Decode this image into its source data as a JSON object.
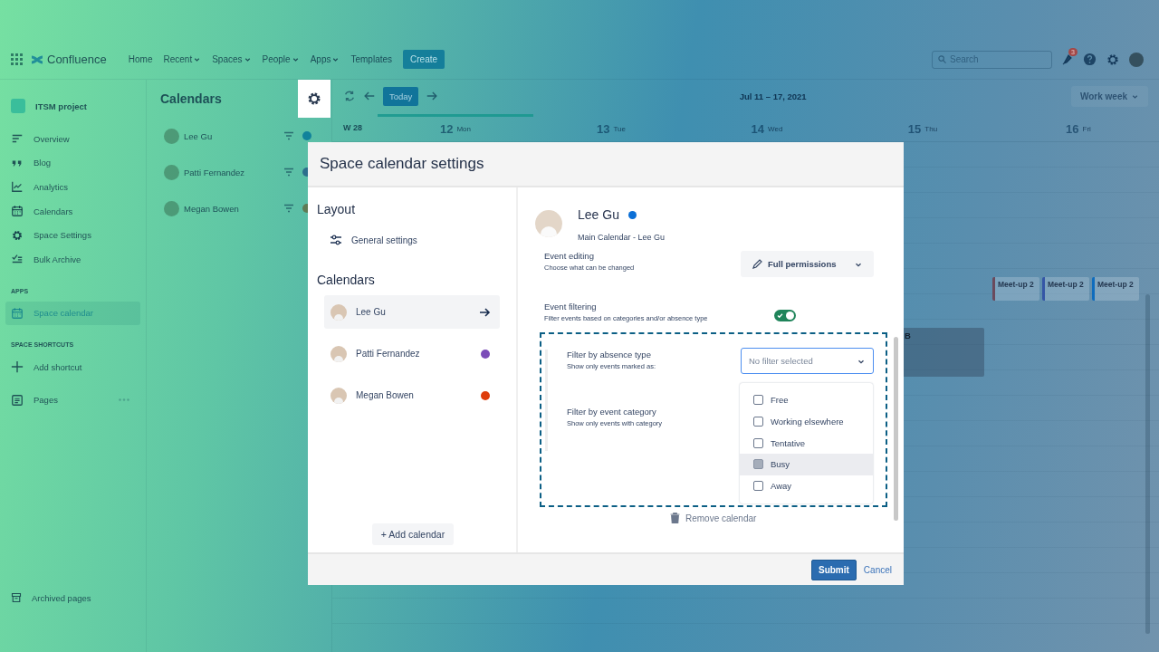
{
  "top_nav": {
    "product": "Confluence",
    "links": [
      {
        "label": "Home",
        "dropdown": false
      },
      {
        "label": "Recent",
        "dropdown": true
      },
      {
        "label": "Spaces",
        "dropdown": true
      },
      {
        "label": "People",
        "dropdown": true
      },
      {
        "label": "Apps",
        "dropdown": true
      },
      {
        "label": "Templates",
        "dropdown": false
      }
    ],
    "create_button": "Create",
    "search": {
      "placeholder": "Search"
    },
    "notification_count": "3"
  },
  "space_sidebar": {
    "space_name": "ITSM project",
    "items": [
      {
        "label": "Overview"
      },
      {
        "label": "Blog"
      },
      {
        "label": "Analytics"
      },
      {
        "label": "Calendars"
      },
      {
        "label": "Space Settings"
      },
      {
        "label": "Bulk Archive"
      }
    ],
    "apps_heading": "APPS",
    "apps": [
      {
        "label": "Space calendar",
        "selected": true
      }
    ],
    "shortcuts_heading": "SPACE SHORTCUTS",
    "add_shortcut": "Add shortcut",
    "pages": "Pages",
    "archived": "Archived pages"
  },
  "calendar_list": {
    "title": "Calendars",
    "items": [
      {
        "name": "Lee Gu",
        "color": "#11829b"
      },
      {
        "name": "Patti Fernandez",
        "color": "#2d6f8c"
      },
      {
        "name": "Megan Bowen",
        "color": "#5f7b55"
      }
    ]
  },
  "calendar": {
    "today_button": "Today",
    "range": "Jul 11 – 17, 2021",
    "view": "Work week",
    "week": "W 28",
    "days": [
      {
        "number": "12",
        "name": "Mon",
        "selected": true
      },
      {
        "number": "13",
        "name": "Tue",
        "selected": false
      },
      {
        "number": "14",
        "name": "Wed",
        "selected": false
      },
      {
        "number": "15",
        "name": "Thu",
        "selected": false
      },
      {
        "number": "16",
        "name": "Fri",
        "selected": false
      }
    ],
    "events": [
      {
        "label": "Meet-up 2",
        "color": "#6b4a5c"
      },
      {
        "label": "Meet-up 2",
        "color": "#3556a6"
      },
      {
        "label": "Meet-up 2",
        "color": "#0f6cbd"
      },
      {
        "label": "B"
      }
    ]
  },
  "modal": {
    "title": "Space calendar settings",
    "layout_heading": "Layout",
    "general_settings": "General settings",
    "calendars_heading": "Calendars",
    "calendars": [
      {
        "name": "Lee Gu",
        "selected": true
      },
      {
        "name": "Patti Fernandez",
        "selected": false,
        "color": "#7b4cb8"
      },
      {
        "name": "Megan Bowen",
        "selected": false,
        "color": "#de3d0b"
      }
    ],
    "add_calendar": "+ Add calendar",
    "detail": {
      "name": "Lee Gu",
      "color": "#0b6fd6",
      "subtitle": "Main Calendar - Lee Gu",
      "event_editing": {
        "label": "Event editing",
        "description": "Choose what can be changed",
        "value": "Full permissions"
      },
      "event_filtering": {
        "label": "Event filtering",
        "description": "Filter events based on categories and/or absence type",
        "on": true
      },
      "absence_filter": {
        "label": "Filter by absence type",
        "description": "Show only events marked as:",
        "placeholder": "No filter selected",
        "expanded": true,
        "options": [
          {
            "label": "Free",
            "checked": false,
            "highlighted": false
          },
          {
            "label": "Working elsewhere",
            "checked": false,
            "highlighted": false
          },
          {
            "label": "Tentative",
            "checked": false,
            "highlighted": false
          },
          {
            "label": "Busy",
            "checked": false,
            "highlighted": true
          },
          {
            "label": "Away",
            "checked": false,
            "highlighted": false
          }
        ]
      },
      "category_filter": {
        "label": "Filter by event category",
        "description": "Show only events with category"
      },
      "remove_button": "Remove calendar"
    },
    "buttons": {
      "submit": "Submit",
      "cancel": "Cancel"
    }
  }
}
